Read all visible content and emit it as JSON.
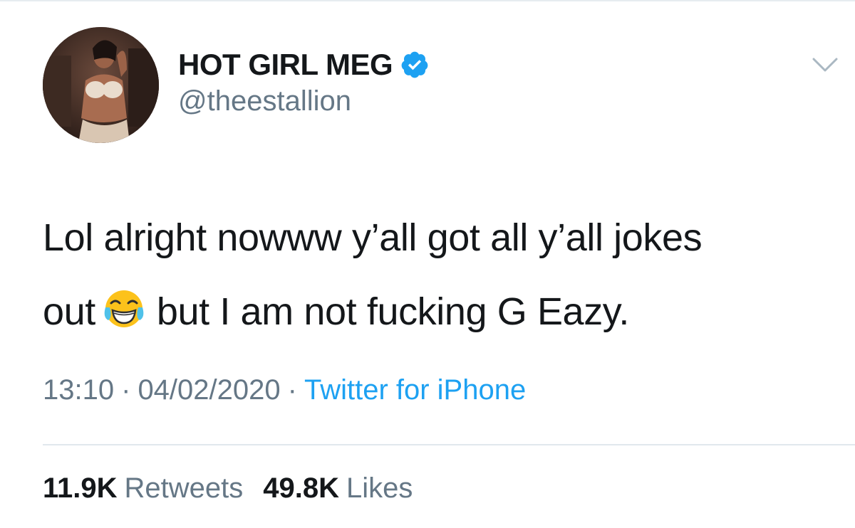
{
  "author": {
    "display_name": "HOT GIRL MEG",
    "handle": "@theestallion",
    "verified": true,
    "avatar_icon": "profile-photo",
    "verified_icon": "verified-badge-icon"
  },
  "tweet": {
    "line1": "Lol alright nowww y’all got all y’all jokes",
    "line2_before": "out",
    "emoji": "😂",
    "emoji_icon": "face-with-tears-of-joy-emoji",
    "line2_after": "but I am not fucking G Eazy."
  },
  "meta": {
    "time": "13:10",
    "separator": "·",
    "date": "04/02/2020",
    "source": "Twitter for iPhone"
  },
  "stats": {
    "retweets_count": "11.9K",
    "retweets_label": "Retweets",
    "likes_count": "49.8K",
    "likes_label": "Likes"
  },
  "colors": {
    "text": "#14171a",
    "secondary": "#657786",
    "link": "#1da1f2",
    "verified": "#1da1f2",
    "divider": "#e1e8ed"
  }
}
